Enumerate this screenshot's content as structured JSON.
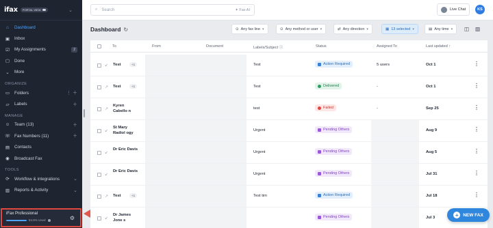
{
  "sidebar": {
    "logo": "ifax",
    "plan_pill": "PORTAL VIEW",
    "items_main": [
      {
        "label": "Dashboard",
        "icon": "home-icon",
        "active": true
      },
      {
        "label": "Inbox",
        "icon": "inbox-icon"
      },
      {
        "label": "My Assignments",
        "icon": "assignment-icon",
        "badge": "2"
      },
      {
        "label": "Done",
        "icon": "done-icon"
      },
      {
        "label": "More",
        "icon": "chevron-down-icon"
      }
    ],
    "section_organize": "ORGANIZE",
    "items_organize": [
      {
        "label": "Folders",
        "icon": "folder-icon"
      },
      {
        "label": "Labels",
        "icon": "label-icon"
      }
    ],
    "section_manage": "MANAGE",
    "items_manage": [
      {
        "label": "Team (13)",
        "icon": "team-icon"
      },
      {
        "label": "Fax Numbers (11)",
        "icon": "phone-icon"
      },
      {
        "label": "Contacts",
        "icon": "contacts-icon"
      },
      {
        "label": "Broadcast Fax",
        "icon": "broadcast-icon"
      }
    ],
    "section_tools": "TOOLS",
    "items_tools": [
      {
        "label": "Workflow & integrations",
        "icon": "workflow-icon"
      },
      {
        "label": "Reports & Activity",
        "icon": "reports-icon"
      }
    ],
    "bottom": {
      "plan": "iFax Professional",
      "usage": "84.8% Used",
      "usage_fraction": 0.848
    }
  },
  "topbar": {
    "search_placeholder": "Search",
    "ai_label": "Fax AI",
    "live_chat": "Live Chat",
    "user_initials": "KS"
  },
  "header": {
    "title": "Dashboard",
    "filters": [
      "Any fax line",
      "Any method or user",
      "Any direction",
      "13 selected",
      "Any time"
    ]
  },
  "table": {
    "columns": [
      "To",
      "From",
      "Document",
      "Labels/Subject",
      "Status",
      "Assigned To",
      "Last updated"
    ],
    "rows": [
      {
        "to": "Test",
        "plus": "+1",
        "subject": "Test",
        "status": "Action Required",
        "status_type": "blue",
        "assigned": "5 users",
        "updated": "Oct 1"
      },
      {
        "to": "Test",
        "plus": "+1",
        "subject": "Test",
        "status": "Delivered",
        "status_type": "green",
        "assigned": "-",
        "updated": "Oct 1"
      },
      {
        "to": "Kyren Cabello n",
        "plus": "",
        "subject": "test",
        "status": "Failed",
        "status_type": "red",
        "assigned": "-",
        "updated": "Sep 25"
      },
      {
        "to": "St Mary Radiol ogy",
        "plus": "",
        "subject": "Urgent",
        "status": "Pending Others",
        "status_type": "purple",
        "assigned": "",
        "updated": "Aug 9"
      },
      {
        "to": "Dr Eric Davis",
        "plus": "",
        "subject": "Urgent",
        "status": "Pending Others",
        "status_type": "purple",
        "assigned": "",
        "updated": "Aug 5"
      },
      {
        "to": "Dr Eric Davis",
        "plus": "",
        "subject": "Urgent",
        "status": "Pending Others",
        "status_type": "purple",
        "assigned": "",
        "updated": "Jul 31"
      },
      {
        "to": "Test",
        "plus": "+1",
        "subject": "Test tim",
        "status": "Action Required",
        "status_type": "blue",
        "assigned": "",
        "updated": "Jul 18"
      },
      {
        "to": "Dr James Jone s",
        "plus": "",
        "subject": "",
        "status": "Pending Others",
        "status_type": "purple",
        "assigned": "",
        "updated": "Jul 3"
      }
    ]
  },
  "new_fax": "NEW FAX",
  "colors": {
    "accent": "#2f86dd",
    "sidebar_bg": "#1e2430",
    "highlight": "#e2483f"
  }
}
